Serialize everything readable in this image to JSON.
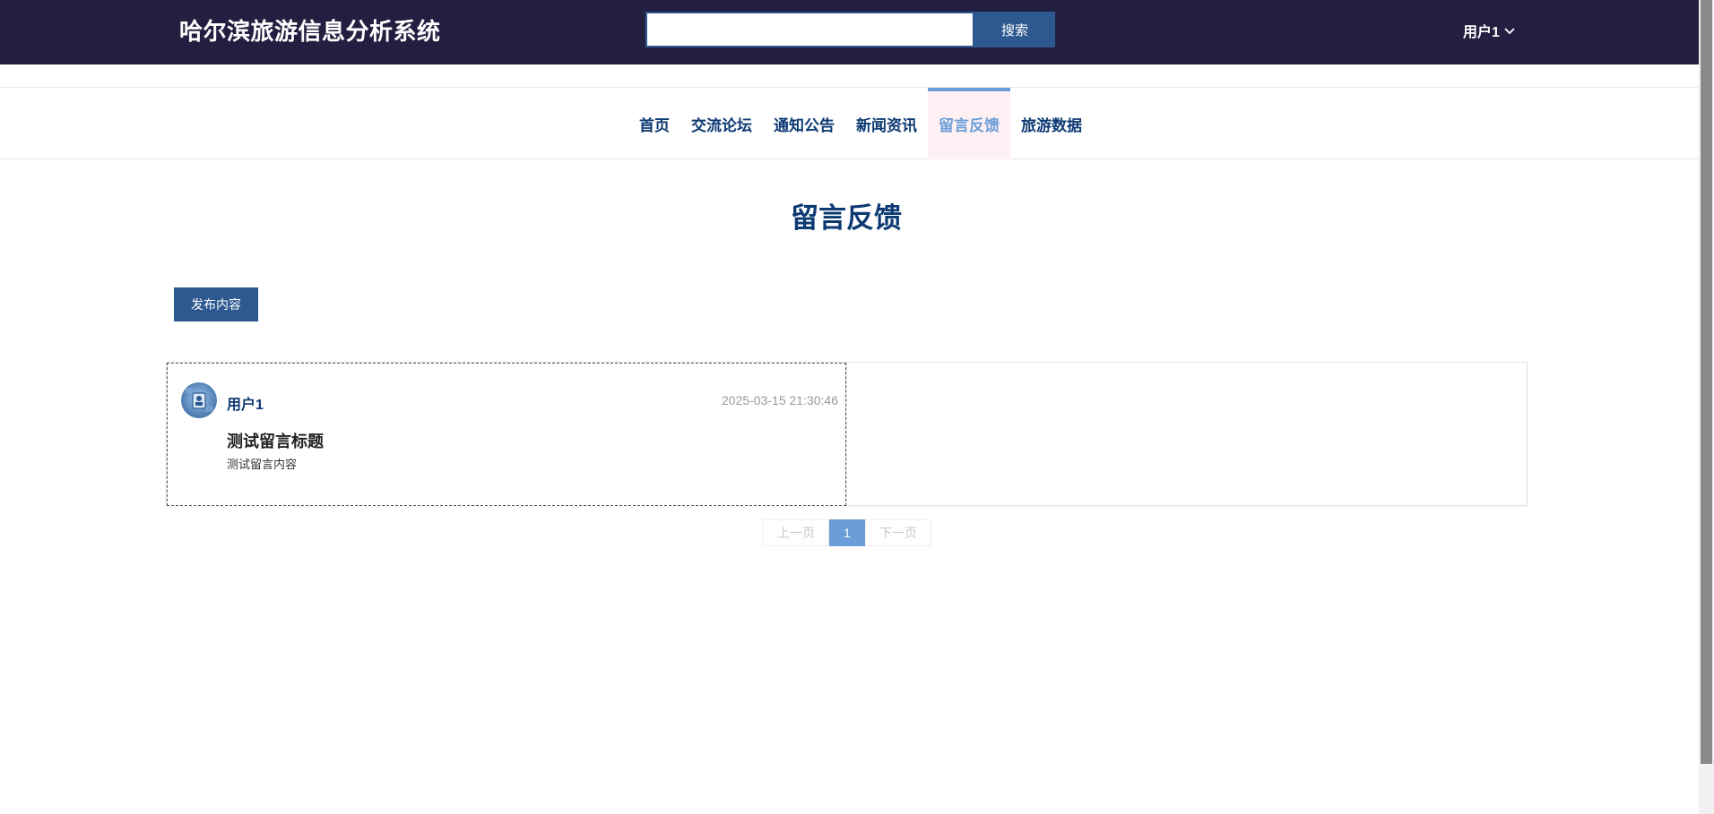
{
  "header": {
    "app_title": "哈尔滨旅游信息分析系统",
    "search_value": "",
    "search_button": "搜索",
    "user_menu": "用户1"
  },
  "nav": {
    "items": [
      {
        "label": "首页",
        "active": false
      },
      {
        "label": "交流论坛",
        "active": false
      },
      {
        "label": "通知公告",
        "active": false
      },
      {
        "label": "新闻资讯",
        "active": false
      },
      {
        "label": "留言反馈",
        "active": true
      },
      {
        "label": "旅游数据",
        "active": false
      }
    ]
  },
  "main": {
    "heading": "留言反馈",
    "publish_button": "发布内容",
    "messages": [
      {
        "user": "用户1",
        "time": "2025-03-15 21:30:46",
        "title": "测试留言标题",
        "content": "测试留言内容"
      }
    ]
  },
  "pagination": {
    "prev": "上一页",
    "current": "1",
    "next": "下一页"
  },
  "colors": {
    "header_bg": "#231f40",
    "primary_button": "#2d5890",
    "nav_text": "#0d3a73",
    "nav_active": "#6b9ed8",
    "nav_active_bg": "#fff1f3"
  },
  "icons": {
    "user_menu": "chevron-down-icon",
    "avatar": "user-avatar-image"
  }
}
